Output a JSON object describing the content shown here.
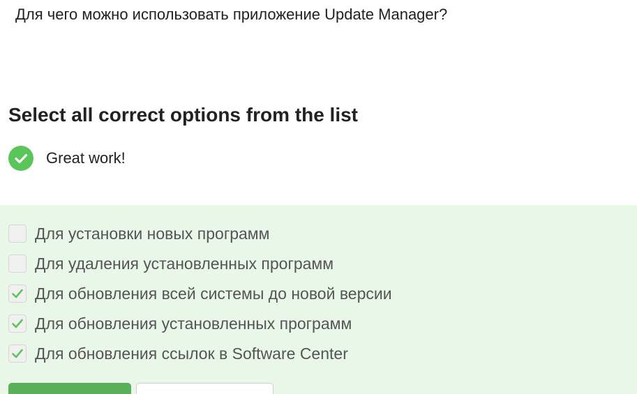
{
  "question": {
    "text": "Для чего можно использовать приложение Update Manager?"
  },
  "instruction": "Select all correct options from the list",
  "feedback": {
    "icon": "check-circle-icon",
    "text": "Great work!",
    "color": "#5ac65a"
  },
  "options": [
    {
      "label": "Для установки новых программ",
      "checked": false
    },
    {
      "label": "Для удаления установленных программ",
      "checked": false
    },
    {
      "label": "Для обновления всей системы до новой версии",
      "checked": true
    },
    {
      "label": "Для обновления установленных программ",
      "checked": true
    },
    {
      "label": "Для обновления ссылок в Software Center",
      "checked": true
    }
  ],
  "colors": {
    "panel_background": "#e8f7e8",
    "accent": "#59b059",
    "checkmark": "#5ac65a"
  }
}
